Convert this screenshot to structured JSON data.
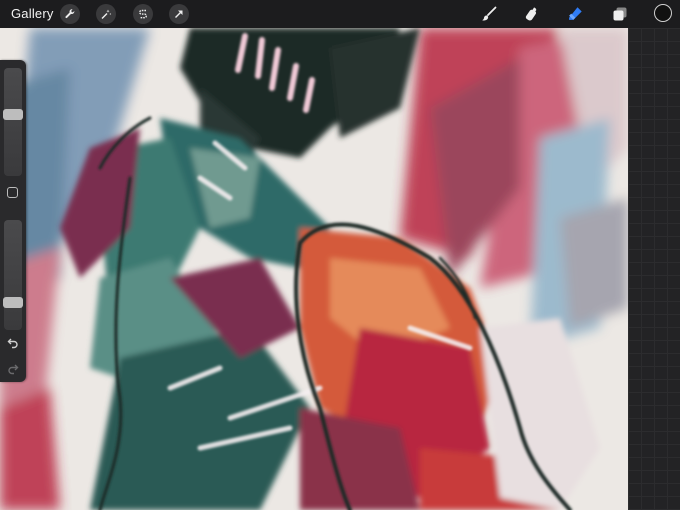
{
  "topbar": {
    "gallery_label": "Gallery",
    "left_tools": [
      "wrench-icon",
      "magic-wand-icon",
      "selection-s-icon",
      "transform-arrow-icon"
    ],
    "right_tools": [
      "brush-icon",
      "smudge-icon",
      "eraser-icon",
      "layers-icon"
    ],
    "active_tool": "eraser-icon",
    "accent_color": "#2f7cf6",
    "current_color": "#111111"
  },
  "sidebar": {
    "brush_size_level": 0.58,
    "opacity_level": 0.22,
    "modify_button": "square-modify-icon",
    "undo": "undo-icon",
    "redo": "redo-icon"
  },
  "canvas": {
    "artwork": "watercolor-painting",
    "palette": [
      "#b8283f",
      "#2f6a68",
      "#7a2e50",
      "#6f90b0",
      "#d45a3a",
      "#1f2a28"
    ]
  }
}
